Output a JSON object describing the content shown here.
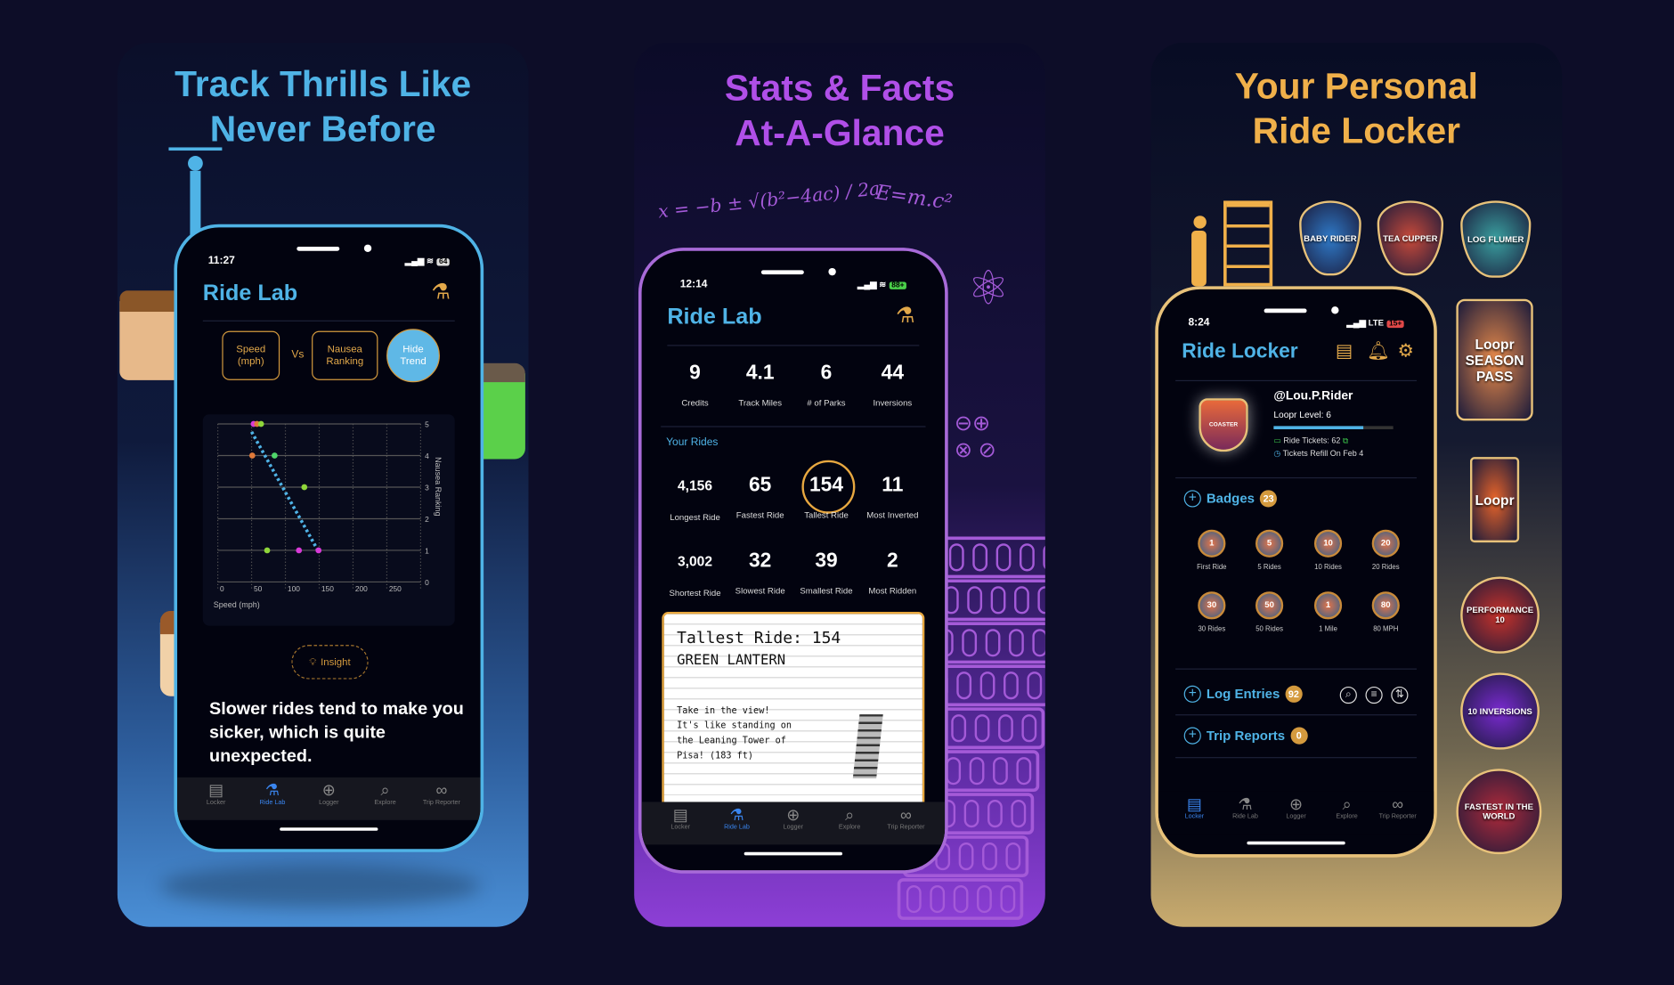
{
  "colors": {
    "bg": "#0d0d28",
    "blue": "#4fb3e6",
    "purple": "#b04fe8",
    "gold": "#f0b04a",
    "accent_tab": "#3a86f0",
    "badge_count": "#d49a3e"
  },
  "tabs": [
    {
      "label": "Locker",
      "icon": "list-icon"
    },
    {
      "label": "Ride Lab",
      "icon": "flask-icon"
    },
    {
      "label": "Logger",
      "icon": "plus-circle-icon"
    },
    {
      "label": "Explore",
      "icon": "magnifier-icon"
    },
    {
      "label": "Trip Reporter",
      "icon": "binoculars-icon"
    }
  ],
  "panel1": {
    "headline": [
      "Track Thrills Like",
      "Never Before"
    ],
    "status": {
      "time": "11:27",
      "battery": "64"
    },
    "title": "Ride Lab",
    "selector": {
      "x_label": "Speed (mph)",
      "vs": "Vs",
      "y_label": "Nausea Ranking",
      "trend_button": "Hide Trend"
    },
    "insight_button": "Insight",
    "insight_text": "Slower rides tend to make you sicker, which is quite unexpected.",
    "active_tab": "Ride Lab"
  },
  "chart_data": {
    "type": "scatter",
    "xlabel": "Speed (mph)",
    "ylabel": "Nausea Ranking",
    "xlim": [
      0,
      300
    ],
    "ylim": [
      0,
      5
    ],
    "x_ticks": [
      "0",
      "50",
      "100",
      "150",
      "200",
      "250"
    ],
    "y_ticks": [
      "0",
      "1",
      "2",
      "3",
      "4",
      "5"
    ],
    "grid": true,
    "points": [
      {
        "x": 53,
        "y": 5,
        "color": "#d83ad8"
      },
      {
        "x": 58,
        "y": 5,
        "color": "#e07a3a"
      },
      {
        "x": 64,
        "y": 5,
        "color": "#8fd63a"
      },
      {
        "x": 51,
        "y": 4,
        "color": "#e07a3a"
      },
      {
        "x": 84,
        "y": 4,
        "color": "#4fd66a"
      },
      {
        "x": 128,
        "y": 3,
        "color": "#8fd63a"
      },
      {
        "x": 73,
        "y": 1,
        "color": "#8fd63a"
      },
      {
        "x": 120,
        "y": 1,
        "color": "#d83ad8"
      },
      {
        "x": 149,
        "y": 1,
        "color": "#d83ad8"
      }
    ],
    "trend": {
      "from": [
        50,
        4.75
      ],
      "to": [
        148,
        1
      ],
      "color": "#4fb3e6",
      "style": "dotted"
    }
  },
  "panel2": {
    "headline": [
      "Stats & Facts",
      "At-A-Glance"
    ],
    "formula": "x = −b ± √(b²−4ac) / 2a",
    "formula2": "E=m.c²",
    "status": {
      "time": "12:14",
      "battery": "88+"
    },
    "title": "Ride Lab",
    "summary": [
      {
        "n": "9",
        "l": "Credits"
      },
      {
        "n": "4.1",
        "l": "Track Miles"
      },
      {
        "n": "6",
        "l": "# of Parks"
      },
      {
        "n": "44",
        "l": "Inversions"
      }
    ],
    "section": "Your Rides",
    "rides1": [
      {
        "n": "4,156",
        "l": "Longest Ride"
      },
      {
        "n": "65",
        "l": "Fastest Ride"
      },
      {
        "n": "154",
        "l": "Tallest Ride"
      },
      {
        "n": "11",
        "l": "Most Inverted"
      }
    ],
    "rides2": [
      {
        "n": "3,002",
        "l": "Shortest Ride"
      },
      {
        "n": "32",
        "l": "Slowest Ride"
      },
      {
        "n": "39",
        "l": "Smallest Ride"
      },
      {
        "n": "2",
        "l": "Most Ridden"
      }
    ],
    "note": {
      "line1": "Tallest Ride: 154",
      "line2": "GREEN LANTERN",
      "body": [
        "Take in the view!",
        "It's like standing on",
        "the Leaning Tower of",
        "Pisa! (183 ft)"
      ]
    },
    "active_tab": "Ride Lab"
  },
  "panel3": {
    "headline": [
      "Your Personal",
      "Ride Locker"
    ],
    "stickers": [
      "BABY RIDER",
      "TEA CUPPER",
      "LOG FLUMER",
      "Loopr SEASON PASS",
      "Loopr",
      "PERFORMANCE 10",
      "10 INVERSIONS",
      "FASTEST IN THE WORLD"
    ],
    "status": {
      "time": "8:24",
      "network": "LTE",
      "battery": "15+"
    },
    "title": "Ride Locker",
    "avatar_text": "COASTER",
    "user": {
      "handle": "@Lou.P.Rider",
      "level": "Loopr Level: 6",
      "level_progress": 0.75,
      "tickets": "Ride Tickets: 62",
      "refill": "Tickets Refill On Feb 4"
    },
    "badges_label": "Badges",
    "badges_count": "23",
    "badges": [
      {
        "t": "1",
        "l": "First Ride"
      },
      {
        "t": "5",
        "l": "5 Rides"
      },
      {
        "t": "10",
        "l": "10 Rides"
      },
      {
        "t": "20",
        "l": "20 Rides"
      },
      {
        "t": "30",
        "l": "30 Rides"
      },
      {
        "t": "50",
        "l": "50 Rides"
      },
      {
        "t": "1",
        "l": "1 Mile"
      },
      {
        "t": "80",
        "l": "80 MPH"
      }
    ],
    "log_label": "Log Entries",
    "log_count": "92",
    "trip_label": "Trip Reports",
    "trip_count": "0",
    "active_tab": "Locker"
  }
}
